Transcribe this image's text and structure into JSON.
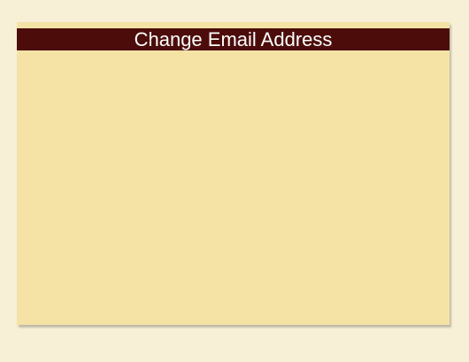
{
  "dialog": {
    "title": "Change Email Address"
  },
  "colors": {
    "page_background": "#f7efd6",
    "dialog_background": "#f5e3a6",
    "titlebar_background": "#4c0d0a",
    "title_text": "#ffffff"
  }
}
